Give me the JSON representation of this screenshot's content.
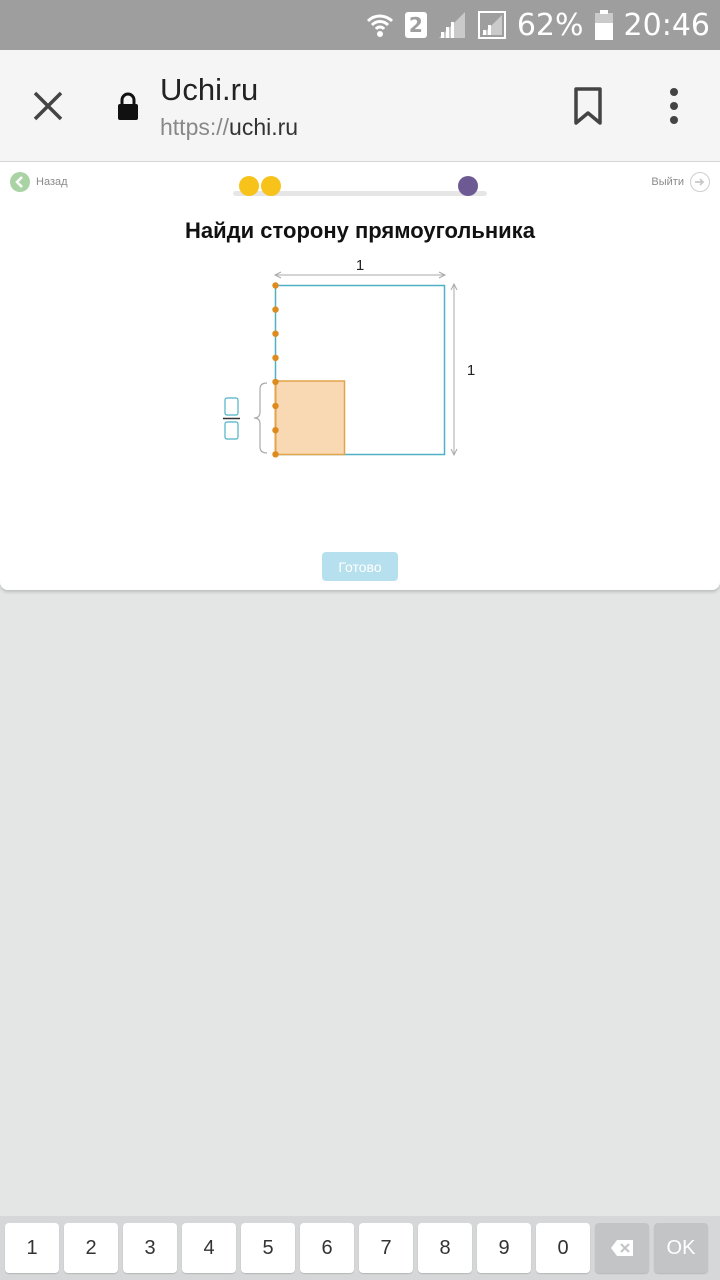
{
  "status_bar": {
    "sim_slot": "2",
    "battery": "62%",
    "time": "20:46",
    "icons": [
      "wifi-icon",
      "signal-icon",
      "signal-icon-2",
      "battery-icon"
    ]
  },
  "browser": {
    "site_title": "Uchi.ru",
    "url_scheme": "https://",
    "url_host": "uchi.ru",
    "icons": [
      "close-icon",
      "lock-icon",
      "bookmark-icon",
      "more-vertical-icon"
    ]
  },
  "lesson": {
    "back_label": "Назад",
    "exit_label": "Выйти",
    "progress_dot_colors": [
      "#f7c21a",
      "#f7c21a",
      "#6e5a93"
    ],
    "title": "Найди сторону прямоугольника",
    "done_label": "Готово"
  },
  "figure": {
    "top_label": "1",
    "side_label": "1",
    "colors": {
      "square_border": "#4fb0c6",
      "fill": "#f9d9b3",
      "fill_border": "#e3a34a",
      "dot": "#dd8a1e",
      "dimension": "#aaaaaa"
    }
  },
  "keyboard": {
    "keys": [
      "1",
      "2",
      "3",
      "4",
      "5",
      "6",
      "7",
      "8",
      "9",
      "0"
    ],
    "ok_label": "OK",
    "backspace_icon": "backspace-icon"
  }
}
